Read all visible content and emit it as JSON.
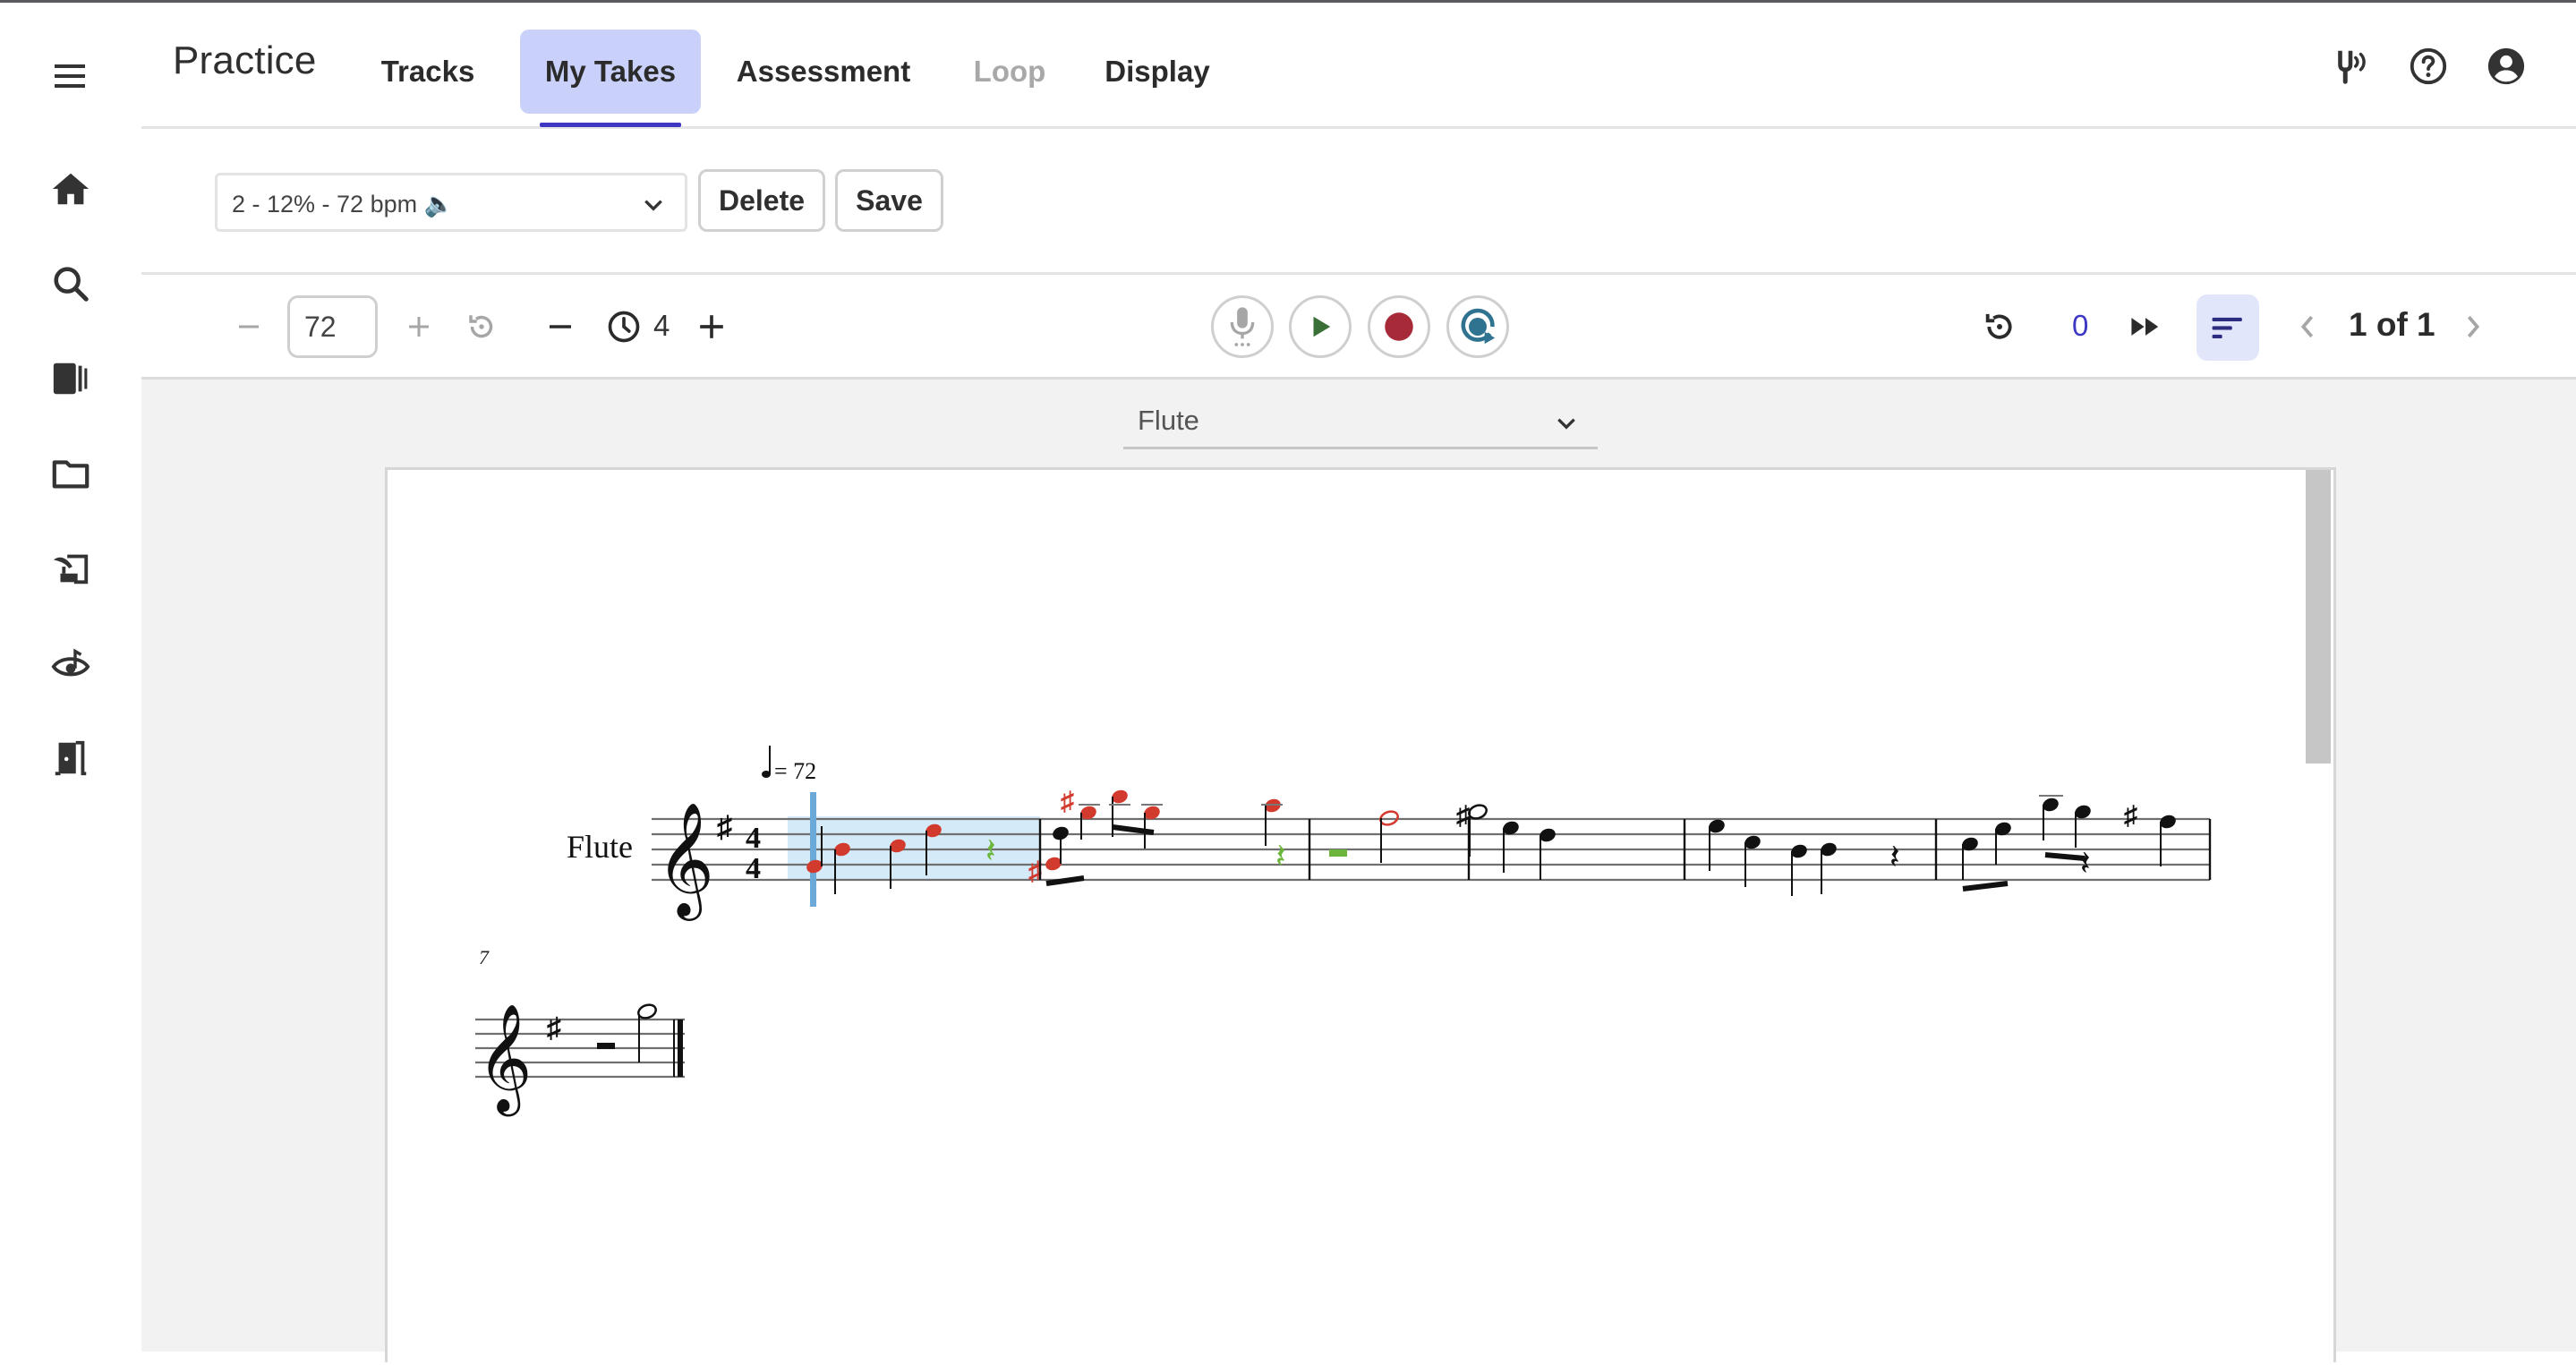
{
  "header": {
    "title": "Practice",
    "tabs": [
      {
        "label": "Tracks",
        "state": "normal"
      },
      {
        "label": "My Takes",
        "state": "active"
      },
      {
        "label": "Assessment",
        "state": "normal"
      },
      {
        "label": "Loop",
        "state": "disabled"
      },
      {
        "label": "Display",
        "state": "normal"
      }
    ],
    "right_icons": [
      "tuning-fork-icon",
      "help-icon",
      "account-icon"
    ]
  },
  "sidebar": {
    "menu_icon": "hamburger-menu-icon",
    "items": [
      {
        "name": "home",
        "icon": "home-icon"
      },
      {
        "name": "search",
        "icon": "search-icon"
      },
      {
        "name": "library",
        "icon": "library-icon"
      },
      {
        "name": "folder",
        "icon": "folder-icon"
      },
      {
        "name": "compose",
        "icon": "compose-icon"
      },
      {
        "name": "listen",
        "icon": "eye-music-icon"
      },
      {
        "name": "exit",
        "icon": "exit-door-icon"
      }
    ]
  },
  "takes_toolbar": {
    "selected_take": "2 - 12% - 72 bpm 🔈",
    "delete_label": "Delete",
    "save_label": "Save"
  },
  "transport": {
    "tempo_value": "72",
    "count_in": "4",
    "take_counter": "0",
    "page_indicator": "1 of 1"
  },
  "score": {
    "part_selected": "Flute",
    "instrument_label": "Flute",
    "tempo_marking": "= 72",
    "time_signature": [
      "4",
      "4"
    ],
    "key_signature": "1 sharp (G major)",
    "second_system_measure_number": "7",
    "scroll_position": 0.0
  },
  "colors": {
    "accent": "#3d37c3",
    "tab_active_bg": "#c9d1fa",
    "sort_active_bg": "#e2e6fb",
    "play": "#3a7038",
    "record": "#a62a38",
    "loop_record": "#2f7390",
    "wrong_note": "#d23a2e",
    "correct_rest": "#6bb63a",
    "cursor": "#6aa9d8",
    "selection": "#d4eaf8"
  }
}
